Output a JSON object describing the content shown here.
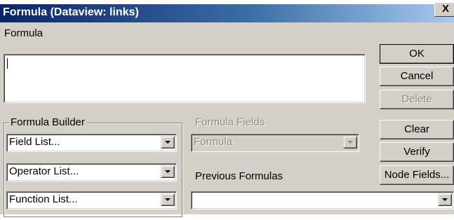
{
  "window": {
    "title": "Formula (Dataview: links)",
    "close_glyph": "X"
  },
  "formula": {
    "label": "Formula",
    "value": ""
  },
  "buttons": {
    "ok": "OK",
    "cancel": "Cancel",
    "delete": "Delete",
    "clear": "Clear",
    "verify": "Verify",
    "node_fields": "Node Fields..."
  },
  "formula_builder": {
    "label": "Formula Builder",
    "field_list": "Field List...",
    "operator_list": "Operator List...",
    "function_list": "Function List..."
  },
  "formula_fields": {
    "label": "Formula Fields",
    "selected": "Formula"
  },
  "previous_formulas": {
    "label": "Previous Formulas",
    "selected": ""
  },
  "icons": {
    "dropdown": "chevron-down-icon",
    "close": "close-icon"
  }
}
